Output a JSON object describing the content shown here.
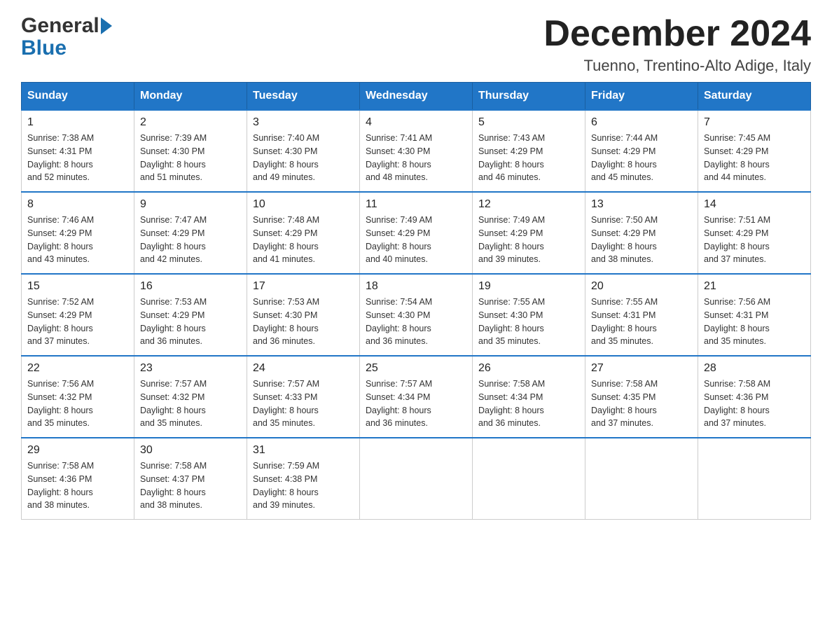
{
  "logo": {
    "general": "General",
    "blue": "Blue",
    "arrow": "▶"
  },
  "header": {
    "month_year": "December 2024",
    "location": "Tuenno, Trentino-Alto Adige, Italy"
  },
  "weekdays": [
    "Sunday",
    "Monday",
    "Tuesday",
    "Wednesday",
    "Thursday",
    "Friday",
    "Saturday"
  ],
  "weeks": [
    [
      {
        "day": "1",
        "sunrise": "7:38 AM",
        "sunset": "4:31 PM",
        "daylight": "8 hours and 52 minutes."
      },
      {
        "day": "2",
        "sunrise": "7:39 AM",
        "sunset": "4:30 PM",
        "daylight": "8 hours and 51 minutes."
      },
      {
        "day": "3",
        "sunrise": "7:40 AM",
        "sunset": "4:30 PM",
        "daylight": "8 hours and 49 minutes."
      },
      {
        "day": "4",
        "sunrise": "7:41 AM",
        "sunset": "4:30 PM",
        "daylight": "8 hours and 48 minutes."
      },
      {
        "day": "5",
        "sunrise": "7:43 AM",
        "sunset": "4:29 PM",
        "daylight": "8 hours and 46 minutes."
      },
      {
        "day": "6",
        "sunrise": "7:44 AM",
        "sunset": "4:29 PM",
        "daylight": "8 hours and 45 minutes."
      },
      {
        "day": "7",
        "sunrise": "7:45 AM",
        "sunset": "4:29 PM",
        "daylight": "8 hours and 44 minutes."
      }
    ],
    [
      {
        "day": "8",
        "sunrise": "7:46 AM",
        "sunset": "4:29 PM",
        "daylight": "8 hours and 43 minutes."
      },
      {
        "day": "9",
        "sunrise": "7:47 AM",
        "sunset": "4:29 PM",
        "daylight": "8 hours and 42 minutes."
      },
      {
        "day": "10",
        "sunrise": "7:48 AM",
        "sunset": "4:29 PM",
        "daylight": "8 hours and 41 minutes."
      },
      {
        "day": "11",
        "sunrise": "7:49 AM",
        "sunset": "4:29 PM",
        "daylight": "8 hours and 40 minutes."
      },
      {
        "day": "12",
        "sunrise": "7:49 AM",
        "sunset": "4:29 PM",
        "daylight": "8 hours and 39 minutes."
      },
      {
        "day": "13",
        "sunrise": "7:50 AM",
        "sunset": "4:29 PM",
        "daylight": "8 hours and 38 minutes."
      },
      {
        "day": "14",
        "sunrise": "7:51 AM",
        "sunset": "4:29 PM",
        "daylight": "8 hours and 37 minutes."
      }
    ],
    [
      {
        "day": "15",
        "sunrise": "7:52 AM",
        "sunset": "4:29 PM",
        "daylight": "8 hours and 37 minutes."
      },
      {
        "day": "16",
        "sunrise": "7:53 AM",
        "sunset": "4:29 PM",
        "daylight": "8 hours and 36 minutes."
      },
      {
        "day": "17",
        "sunrise": "7:53 AM",
        "sunset": "4:30 PM",
        "daylight": "8 hours and 36 minutes."
      },
      {
        "day": "18",
        "sunrise": "7:54 AM",
        "sunset": "4:30 PM",
        "daylight": "8 hours and 36 minutes."
      },
      {
        "day": "19",
        "sunrise": "7:55 AM",
        "sunset": "4:30 PM",
        "daylight": "8 hours and 35 minutes."
      },
      {
        "day": "20",
        "sunrise": "7:55 AM",
        "sunset": "4:31 PM",
        "daylight": "8 hours and 35 minutes."
      },
      {
        "day": "21",
        "sunrise": "7:56 AM",
        "sunset": "4:31 PM",
        "daylight": "8 hours and 35 minutes."
      }
    ],
    [
      {
        "day": "22",
        "sunrise": "7:56 AM",
        "sunset": "4:32 PM",
        "daylight": "8 hours and 35 minutes."
      },
      {
        "day": "23",
        "sunrise": "7:57 AM",
        "sunset": "4:32 PM",
        "daylight": "8 hours and 35 minutes."
      },
      {
        "day": "24",
        "sunrise": "7:57 AM",
        "sunset": "4:33 PM",
        "daylight": "8 hours and 35 minutes."
      },
      {
        "day": "25",
        "sunrise": "7:57 AM",
        "sunset": "4:34 PM",
        "daylight": "8 hours and 36 minutes."
      },
      {
        "day": "26",
        "sunrise": "7:58 AM",
        "sunset": "4:34 PM",
        "daylight": "8 hours and 36 minutes."
      },
      {
        "day": "27",
        "sunrise": "7:58 AM",
        "sunset": "4:35 PM",
        "daylight": "8 hours and 37 minutes."
      },
      {
        "day": "28",
        "sunrise": "7:58 AM",
        "sunset": "4:36 PM",
        "daylight": "8 hours and 37 minutes."
      }
    ],
    [
      {
        "day": "29",
        "sunrise": "7:58 AM",
        "sunset": "4:36 PM",
        "daylight": "8 hours and 38 minutes."
      },
      {
        "day": "30",
        "sunrise": "7:58 AM",
        "sunset": "4:37 PM",
        "daylight": "8 hours and 38 minutes."
      },
      {
        "day": "31",
        "sunrise": "7:59 AM",
        "sunset": "4:38 PM",
        "daylight": "8 hours and 39 minutes."
      },
      null,
      null,
      null,
      null
    ]
  ],
  "labels": {
    "sunrise": "Sunrise:",
    "sunset": "Sunset:",
    "daylight": "Daylight:"
  }
}
